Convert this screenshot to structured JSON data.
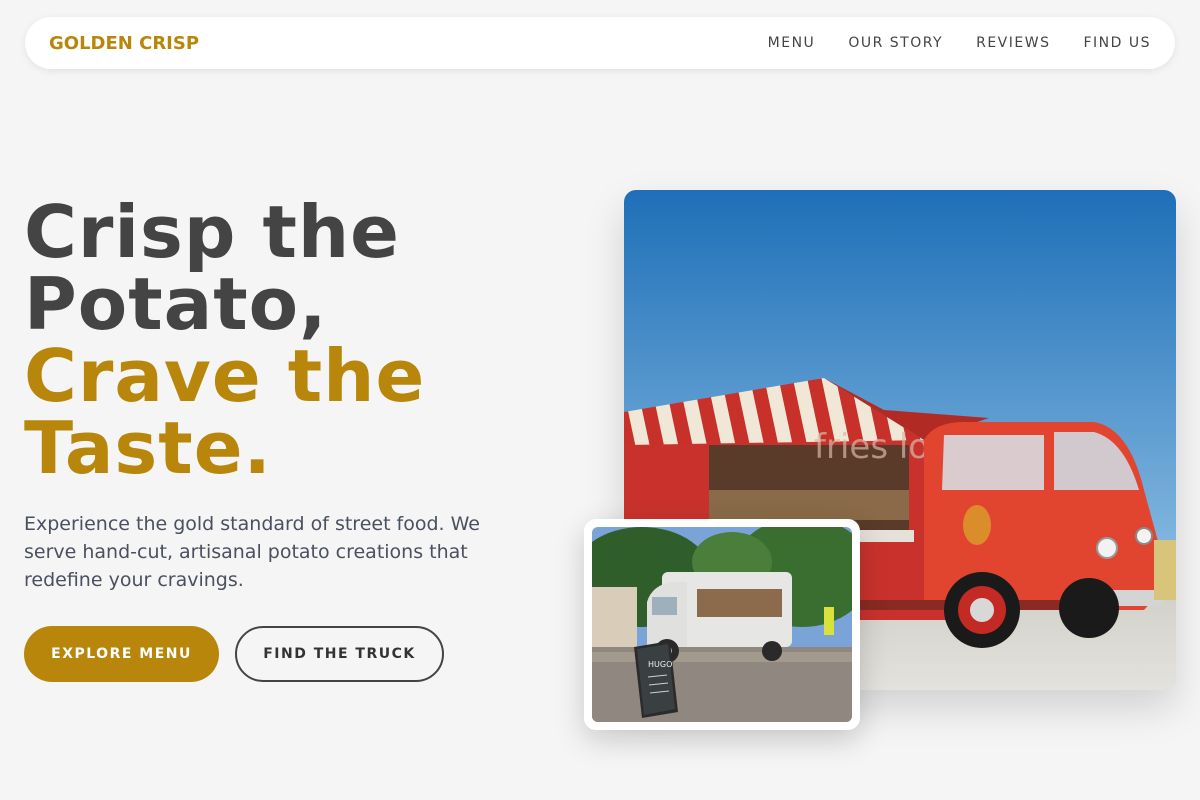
{
  "brand": {
    "name": "GOLDEN CRISP",
    "accent": "#b8860b"
  },
  "nav": {
    "items": [
      {
        "label": "MENU"
      },
      {
        "label": "OUR STORY"
      },
      {
        "label": "REVIEWS"
      },
      {
        "label": "FIND US"
      }
    ]
  },
  "hero": {
    "title_line1": "Crisp the",
    "title_line2": "Potato,",
    "title_line3": "Crave the",
    "title_line4": "Taste.",
    "subtitle": "Experience the gold standard of street food. We serve hand-cut, artisanal potato creations that redefine your cravings.",
    "primary_button": "EXPLORE MENU",
    "secondary_button": "FIND THE TRUCK"
  },
  "images": {
    "main": {
      "sign_text": "fries love"
    },
    "secondary": {
      "board_text": "HUGO"
    }
  }
}
